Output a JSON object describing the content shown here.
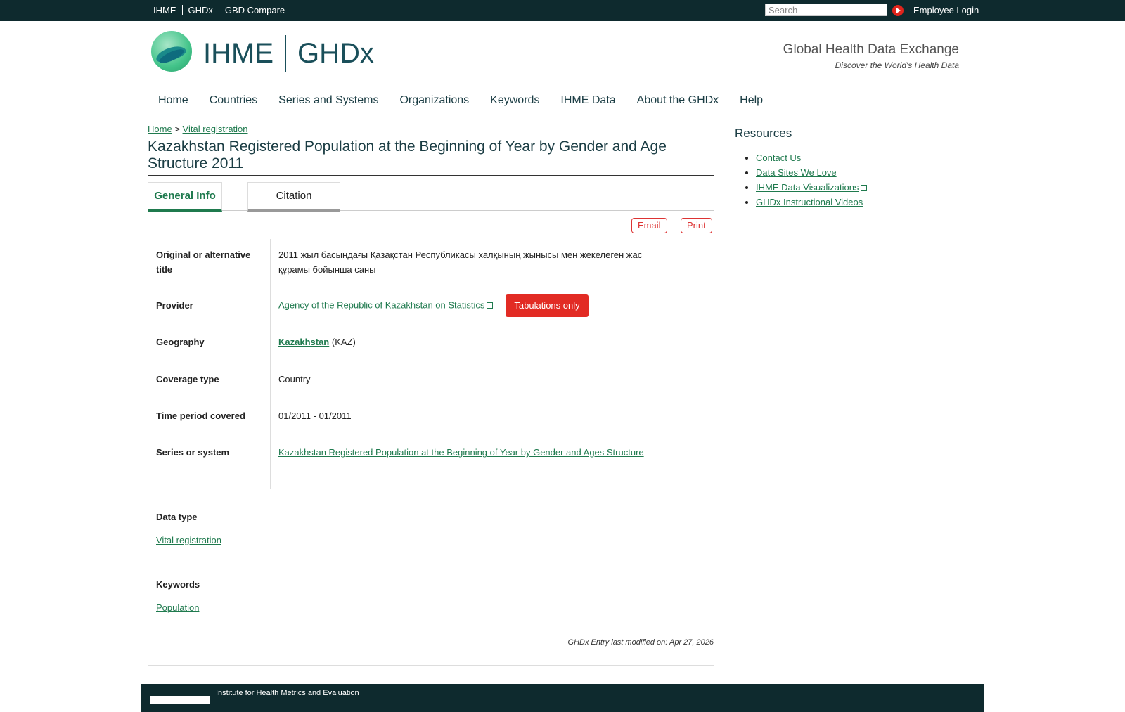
{
  "topbar": {
    "links": [
      "IHME",
      "GHDx",
      "GBD Compare"
    ],
    "search_placeholder": "Search",
    "login": "Employee Login"
  },
  "header": {
    "brand_left": "IHME",
    "brand_right": "GHDx",
    "tagline_title": "Global Health Data Exchange",
    "tagline_sub": "Discover the World's Health Data"
  },
  "nav": [
    "Home",
    "Countries",
    "Series and Systems",
    "Organizations",
    "Keywords",
    "IHME Data",
    "About the GHDx",
    "Help"
  ],
  "breadcrumb": {
    "home": "Home",
    "sep": ">",
    "current": "Vital registration"
  },
  "page_title": "Kazakhstan Registered Population at the Beginning of Year by Gender and Age Structure 2011",
  "tabs": {
    "general": "General Info",
    "citation": "Citation"
  },
  "actions": {
    "email": "Email",
    "print": "Print"
  },
  "fields": {
    "alt_title_label": "Original or alternative title",
    "alt_title_value": "2011 жыл басындағы Қазақстан Республикасы халқының жынысы мен жекелеген жас құрамы бойынша саны",
    "provider_label": "Provider",
    "provider_value": "Agency of the Republic of Kazakhstan on Statistics",
    "provider_badge": "Tabulations only",
    "geography_label": "Geography",
    "geography_value": "Kazakhstan",
    "geography_code": "(KAZ)",
    "coverage_label": "Coverage type",
    "coverage_value": "Country",
    "time_label": "Time period covered",
    "time_value": "01/2011 - 01/2011",
    "series_label": "Series or system",
    "series_value": "Kazakhstan Registered Population at the Beginning of Year by Gender and Ages Structure"
  },
  "data_type": {
    "label": "Data type",
    "value": "Vital registration"
  },
  "keywords": {
    "label": "Keywords",
    "value": "Population"
  },
  "modified": "GHDx Entry last modified on: Apr 27, 2026",
  "footer": {
    "org": "Institute for Health Metrics and Evaluation"
  },
  "resources": {
    "title": "Resources",
    "items": [
      "Contact Us",
      "Data Sites We Love",
      "IHME Data Visualizations",
      "GHDx Instructional Videos"
    ]
  }
}
